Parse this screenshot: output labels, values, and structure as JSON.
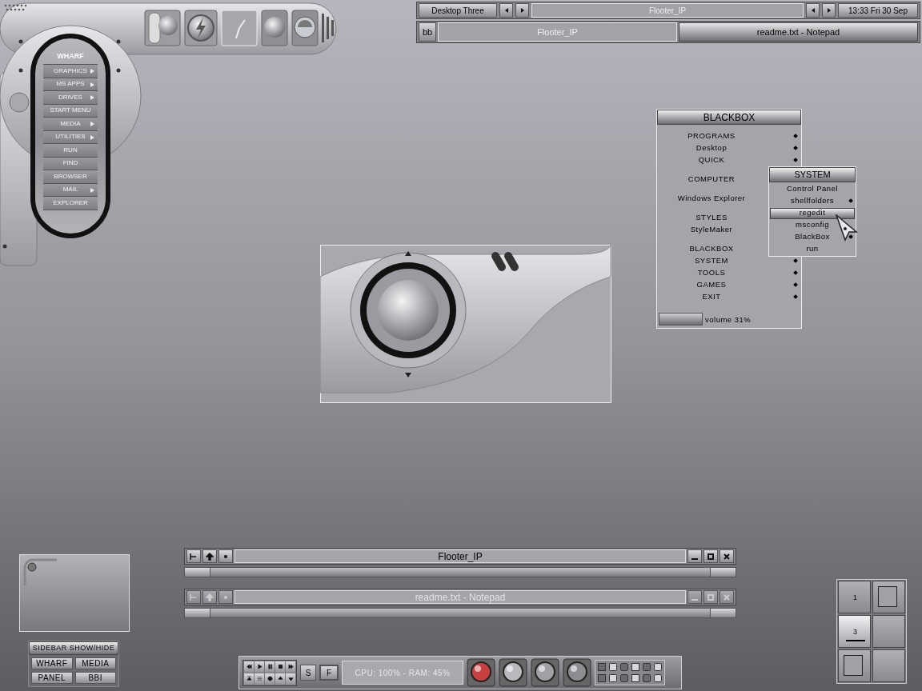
{
  "wharf": {
    "title": "WHARF",
    "items": [
      {
        "label": "GRAPHICS",
        "submenu": true
      },
      {
        "label": "MS APPS",
        "submenu": true
      },
      {
        "label": "DRIVES",
        "submenu": true
      },
      {
        "label": "START MENU",
        "submenu": false
      },
      {
        "label": "MEDIA",
        "submenu": true
      },
      {
        "label": "UTILITIES",
        "submenu": true
      },
      {
        "label": "RUN",
        "submenu": false
      },
      {
        "label": "FIND",
        "submenu": false
      },
      {
        "label": "BROWSER",
        "submenu": false
      },
      {
        "label": "MAIL",
        "submenu": true
      },
      {
        "label": "EXPLORER",
        "submenu": false
      }
    ]
  },
  "top_bar": {
    "workspace": "Desktop Three",
    "window_label": "Flooter_IP",
    "clock": "13:33 Fri 30 Sep"
  },
  "task_bar": {
    "button": "bb",
    "tasks": [
      {
        "label": "Flooter_IP",
        "selected": false
      },
      {
        "label": "readme.txt - Notepad",
        "selected": true
      }
    ]
  },
  "blackbox_menu": {
    "title": "BLACKBOX",
    "groups": [
      [
        {
          "label": "PROGRAMS",
          "submenu": true
        },
        {
          "label": "Desktop",
          "submenu": true
        },
        {
          "label": "QUICK",
          "submenu": true
        }
      ],
      [
        {
          "label": "COMPUTER"
        }
      ],
      [
        {
          "label": "Windows Explorer"
        }
      ],
      [
        {
          "label": "STYLES"
        },
        {
          "label": "StyleMaker"
        }
      ],
      [
        {
          "label": "BLACKBOX"
        },
        {
          "label": "SYSTEM",
          "submenu": true
        },
        {
          "label": "TOOLS",
          "submenu": true
        },
        {
          "label": "GAMES",
          "submenu": true
        },
        {
          "label": "EXIT",
          "submenu": true
        }
      ]
    ],
    "volume": {
      "label": "volume 31%",
      "level": 0.31
    }
  },
  "system_menu": {
    "title": "SYSTEM",
    "items": [
      {
        "label": "Control Panel",
        "submenu": false,
        "selected": false
      },
      {
        "label": "shellfolders",
        "submenu": true,
        "selected": false
      },
      {
        "label": "regedit",
        "submenu": false,
        "selected": true
      },
      {
        "label": "msconfig",
        "submenu": false,
        "selected": false
      },
      {
        "label": "BlackBox",
        "submenu": true,
        "selected": false
      },
      {
        "label": "run",
        "submenu": false,
        "selected": false
      }
    ]
  },
  "windows": [
    {
      "title": "Flooter_IP",
      "active": true
    },
    {
      "title": "readme.txt - Notepad",
      "active": false
    }
  ],
  "sidebar_panel": {
    "title": "SIDEBAR SHOW/HIDE",
    "buttons": [
      "WHARF",
      "MEDIA",
      "PANEL",
      "BBI"
    ]
  },
  "bottom_bar": {
    "buttons": [
      "S",
      "F"
    ],
    "stats": "CPU: 100% - RAM: 45%"
  },
  "pager": {
    "cells": [
      {
        "label": "1",
        "selected": false,
        "has_window": false
      },
      {
        "selected": false,
        "has_window": true
      },
      {
        "label": "3",
        "selected": true,
        "has_window": false
      },
      {
        "selected": false,
        "has_window": false
      },
      {
        "selected": false,
        "has_window": true
      },
      {
        "selected": false,
        "has_window": false
      }
    ]
  }
}
